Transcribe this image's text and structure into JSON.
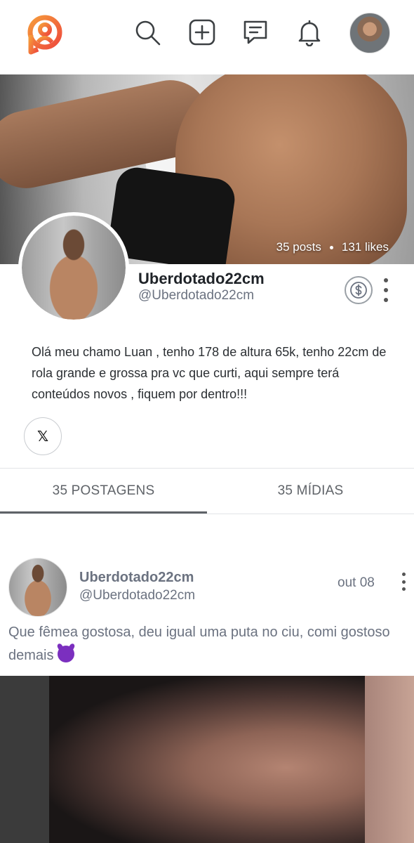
{
  "header": {
    "logo": "brand-logo",
    "icons": [
      "search-icon",
      "add-post-icon",
      "messages-icon",
      "notifications-icon"
    ],
    "accent_color": "#f26b3a"
  },
  "profile": {
    "stats": {
      "posts": "35 posts",
      "likes": "131 likes"
    },
    "display_name": "Uberdotado22cm",
    "handle": "@Uberdotado22cm",
    "bio": "Olá meu chamo Luan , tenho 178 de altura 65k, tenho 22cm de rola grande e grossa pra vc que curti, aqui sempre terá conteúdos novos , fiquem por dentro!!!",
    "social_x_label": "𝕏"
  },
  "tabs": [
    {
      "label": "35 POSTAGENS",
      "active": true
    },
    {
      "label": "35 MÍDIAS",
      "active": false
    }
  ],
  "post": {
    "author_name": "Uberdotado22cm",
    "author_handle": "@Uberdotado22cm",
    "date": "out 08",
    "text": "Que fêmea gostosa, deu igual uma puta no ciu, comi gostoso demais"
  }
}
